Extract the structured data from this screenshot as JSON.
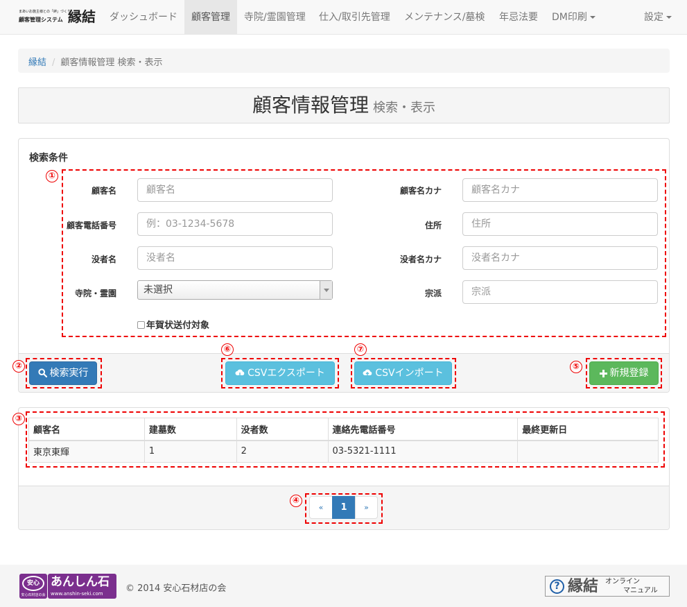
{
  "brand": {
    "tagline": "まあいお施主様との「絆」づくり",
    "system": "顧客管理システム",
    "logo": "縁結"
  },
  "nav": {
    "items": [
      "ダッシュボード",
      "顧客管理",
      "寺院/霊園管理",
      "仕入/取引先管理",
      "メンテナンス/墓検",
      "年忌法要",
      "DM印刷"
    ],
    "settings": "設定",
    "active_item": "顧客管理"
  },
  "breadcrumb": {
    "home": "縁結",
    "current": "顧客情報管理 検索・表示"
  },
  "page_header": {
    "title": "顧客情報管理",
    "subtitle": "検索・表示"
  },
  "search": {
    "heading": "検索条件",
    "fields": {
      "customer_name": {
        "label": "顧客名",
        "placeholder": "顧客名",
        "value": ""
      },
      "customer_kana": {
        "label": "顧客名カナ",
        "placeholder": "顧客名カナ",
        "value": ""
      },
      "phone": {
        "label": "顧客電話番号",
        "placeholder": "例：03-1234-5678",
        "value": ""
      },
      "address": {
        "label": "住所",
        "placeholder": "住所",
        "value": ""
      },
      "deceased": {
        "label": "没者名",
        "placeholder": "没者名",
        "value": ""
      },
      "deceased_kana": {
        "label": "没者名カナ",
        "placeholder": "没者名カナ",
        "value": ""
      },
      "temple": {
        "label": "寺院・霊園",
        "value": "未選択"
      },
      "sect": {
        "label": "宗派",
        "placeholder": "宗派",
        "value": ""
      }
    },
    "checkbox_label": "年賀状送付対象",
    "checkbox_checked": false
  },
  "buttons": {
    "search": "検索実行",
    "csv_export": "CSVエクスポート",
    "csv_import": "CSVインポート",
    "new": "新規登録"
  },
  "annotations": [
    "①",
    "②",
    "③",
    "④",
    "⑤",
    "⑥",
    "⑦"
  ],
  "table": {
    "headers": [
      "顧客名",
      "建墓数",
      "没者数",
      "連絡先電話番号",
      "最終更新日"
    ],
    "rows": [
      [
        "東京東輝",
        "1",
        "2",
        "03-5321-1111",
        ""
      ]
    ]
  },
  "pagination": {
    "prev": "«",
    "current": "1",
    "next": "»"
  },
  "footer": {
    "logo_badge": "安心",
    "logo_badge_sub": "安心石材店の会",
    "logo_text": "あんしん石",
    "logo_url": "www.anshin-seki.com",
    "copyright": "© 2014 安心石材店の会",
    "manual_q": "?",
    "manual_logo": "縁結",
    "manual_line1": "オンライン",
    "manual_line2": "マニュアル"
  },
  "colors": {
    "primary": "#337ab7",
    "info": "#5bc0de",
    "success": "#5cb85c",
    "annotation": "#ee0000",
    "brand_purple": "#7b2f8e"
  }
}
